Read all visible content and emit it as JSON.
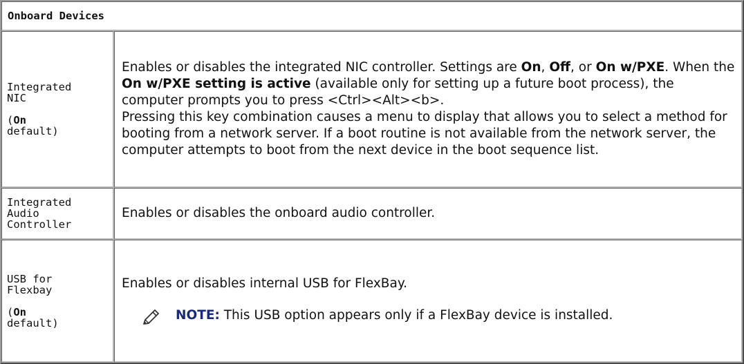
{
  "section_title": "Onboard Devices",
  "rows": [
    {
      "label_lines": [
        "Integrated",
        "NIC"
      ],
      "default_open": "(",
      "default_value": "On",
      "default_close": "default)",
      "desc": {
        "t1": "Enables or disables the integrated NIC controller. Settings are ",
        "b1": "On",
        "t2": ", ",
        "b2": "Off",
        "t3": ", or ",
        "b3": "On w/PXE",
        "t4": ". When the ",
        "b4": "On w/PXE setting is active",
        "t5": " (available only for setting up a future boot process), the computer prompts you to press <Ctrl><Alt><b>.",
        "p2": "Pressing this key combination causes a menu to display that allows you to select a method for booting from a network server. If a boot routine is not available from the network server, the computer attempts to boot from the next device in the boot sequence list."
      }
    },
    {
      "label_lines": [
        "Integrated",
        "Audio",
        "Controller"
      ],
      "desc": "Enables or disables the onboard audio controller."
    },
    {
      "label_lines": [
        "USB for",
        "Flexbay"
      ],
      "default_open": "(",
      "default_value": "On",
      "default_close": "default)",
      "desc": "Enables or disables internal USB for FlexBay.",
      "note": {
        "icon": "pencil-note-icon",
        "title": "NOTE:",
        "text": " This USB option appears only if a FlexBay device is installed."
      }
    }
  ]
}
